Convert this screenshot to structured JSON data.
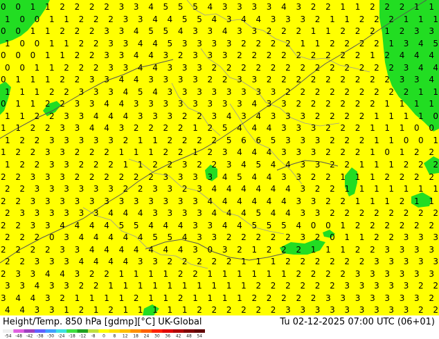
{
  "header": {
    "title": "Height/Temp. 850 hPa [gdmp][°C] UK-Global",
    "valid_time": "Tu 02-12-2025 07:00 UTC (06+01)"
  },
  "legend": {
    "colors": [
      "#f0f0f0",
      "#e060e0",
      "#a040c0",
      "#6060ff",
      "#40a0ff",
      "#40e0e0",
      "#40e040",
      "#20a020",
      "#c0e040",
      "#ffff00",
      "#ffe000",
      "#ffc000",
      "#ff9000",
      "#ff6000",
      "#ff2000",
      "#e00000",
      "#b00000",
      "#800000",
      "#600000"
    ],
    "ticks": [
      "-54",
      "-48",
      "-42",
      "-38",
      "-30",
      "-24",
      "-18",
      "-12",
      "-8",
      "0",
      "8",
      "12",
      "18",
      "24",
      "30",
      "36",
      "42",
      "48",
      "54"
    ]
  },
  "map": {
    "background_color": "#ffff00",
    "cold_color": "#22dd22",
    "border_color": "#999999",
    "coast_color": "#555555",
    "label_color": "#000000",
    "temperature_rows": [
      "0 0 1 1 2 2 2 2 3 3 4 5 5 5 4 3 3 3 3 4 3 2 2 1 1 2 2 2 1 1",
      "1 0 0 1 1 2 2 2 3 3 4 4 5 5 4 3 4 4 3 3 3 2 1 1 2 2 2 1 1 1",
      "0 0 1 1 2 2 2 3 3 4 5 5 4 3 3 4 3 3 2 2 2 1 1 2 2 2 1 2 3 3",
      "1 0 0 1 1 2 2 3 3 4 4 5 3 3 3 3 2 2 2 2 1 1 2 2 2 2 1 3 4 5",
      "0 0 0 1 1 2 2 3 3 4 4 3 2 3 3 3 2 2 2 2 2 2 2 2 2 1 2 4 4 4",
      "0 0 1 1 2 2 2 3 3 4 4 3 3 3 2 2 2 2 2 2 2 2 2 2 2 2 2 3 4 4",
      "0 1 1 1 2 2 3 3 4 4 3 3 3 3 2 2 3 3 2 2 2 2 2 2 2 2 2 3 3 4",
      "1 1 1 2 2 3 3 3 4 5 4 3 3 3 3 3 3 3 3 2 2 2 2 2 2 2 2 2 1 1",
      "0 1 1 2 2 3 3 4 4 3 3 3 3 3 3 3 3 4 3 3 2 2 2 2 2 2 1 1 1 1",
      "1 1 2 2 3 3 4 4 4 3 3 3 2 2 3 4 3 4 3 3 3 2 2 2 2 1 1 1 1 0",
      "1 1 2 2 3 3 4 4 3 2 2 2 2 1 2 5 4 4 4 3 3 3 2 2 2 1 1 1 0 0",
      "1 2 2 3 3 3 3 3 2 1 1 2 2 2 2 5 6 6 5 3 3 3 2 2 2 1 1 0 0 1",
      "1 2 2 3 3 2 2 2 1 1 1 2 2 1 2 3 4 4 4 3 3 3 2 2 2 1 0 1 2 2",
      "1 2 2 3 3 2 2 2 1 1 2 2 3 2 2 3 4 5 4 4 3 3 2 2 1 1 1 2 2 2",
      "2 2 3 3 3 2 2 2 2 2 2 3 3 3 3 4 5 4 4 3 3 2 2 1 1 1 2 2 2 2",
      "2 2 3 3 3 3 3 3 2 2 3 3 2 3 4 4 4 4 4 4 3 2 2 1 1 1 1 1 1 1",
      "2 2 3 3 3 3 3 3 3 3 3 3 3 3 4 4 4 4 4 4 3 3 2 2 1 1 1 2 1 1",
      "2 3 3 3 3 3 3 4 4 4 3 3 3 3 4 4 4 5 4 4 3 3 2 2 2 2 2 2 2 2",
      "2 2 3 3 4 4 4 4 5 5 4 4 4 3 3 4 4 5 5 5 4 0 0 1 2 2 2 2 2 2",
      "2 2 2 0 3 4 4 4 4 4 5 5 4 3 3 2 2 2 2 2 3 2 0 1 1 2 2 3 3 3",
      "2 2 2 2 3 3 4 4 4 4 4 4 4 3 0 3 2 1 2 2 2 1 1 1 2 2 3 3 3 3",
      "2 2 3 3 3 4 4 4 4 3 3 2 2 2 2 2 1 1 1 2 2 2 2 2 2 3 3 3 3 3",
      "2 3 3 4 4 3 2 2 1 1 1 1 2 2 1 1 1 1 1 1 2 2 2 2 3 3 3 3 3 3",
      "3 3 4 3 3 2 2 1 1 1 1 1 1 1 1 1 1 2 2 2 2 2 2 3 3 3 3 3 2 2",
      "3 4 4 3 2 1 1 1 1 2 1 1 2 1 1 1 1 2 2 2 2 2 3 3 3 3 3 3 3 2",
      "4 4 3 3 1 2 1 2 1 1 1 1 1 2 2 2 2 2 2 3 3 3 3 3 3 3 3 3 2 2"
    ]
  }
}
